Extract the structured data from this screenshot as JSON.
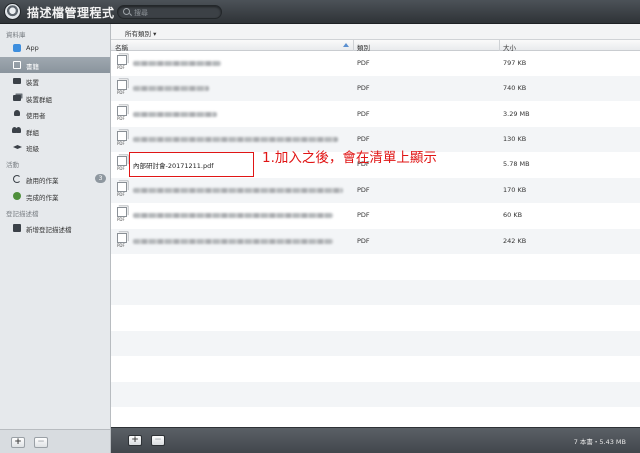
{
  "app": {
    "title": "描述檔管理程式"
  },
  "search": {
    "placeholder": "搜尋"
  },
  "sidebar": {
    "library_heading": "資料庫",
    "library_items": [
      {
        "label": "App",
        "icon": "app-icon",
        "active": false
      },
      {
        "label": "書籍",
        "icon": "book-icon",
        "active": true
      },
      {
        "label": "裝置",
        "icon": "device-icon",
        "active": false
      },
      {
        "label": "裝置群組",
        "icon": "device-group-icon",
        "active": false
      },
      {
        "label": "使用者",
        "icon": "user-icon",
        "active": false
      },
      {
        "label": "群組",
        "icon": "group-icon",
        "active": false
      },
      {
        "label": "班級",
        "icon": "class-icon",
        "active": false
      }
    ],
    "activity_heading": "活動",
    "activity_items": [
      {
        "label": "啟用的作業",
        "icon": "active-tasks-icon",
        "badge": "3"
      },
      {
        "label": "完成的作業",
        "icon": "completed-tasks-icon"
      }
    ],
    "enrollment_heading": "登記描述檔",
    "enrollment_items": [
      {
        "label": "新增登記描述檔",
        "icon": "new-enrollment-icon"
      }
    ],
    "add_label": "+",
    "remove_label": "−"
  },
  "main": {
    "filter_label": "所有類別 ▾",
    "columns": {
      "name": "名稱",
      "type": "類別",
      "size": "大小"
    },
    "rows": [
      {
        "name": "",
        "type": "PDF",
        "size": "797 KB"
      },
      {
        "name": "",
        "type": "PDF",
        "size": "740 KB"
      },
      {
        "name": "",
        "type": "PDF",
        "size": "3.29 MB"
      },
      {
        "name": "",
        "type": "PDF",
        "size": "130 KB"
      },
      {
        "name": "內部研討會-20171211.pdf",
        "type": "PDF",
        "size": "5.78 MB"
      },
      {
        "name": "",
        "type": "PDF",
        "size": "170 KB"
      },
      {
        "name": "",
        "type": "PDF",
        "size": "60 KB"
      },
      {
        "name": "",
        "type": "PDF",
        "size": "242 KB"
      }
    ],
    "doc_tag": "PDF",
    "annotation": "1.加入之後，會在清單上顯示",
    "footer_count": "7 本書・5.43 MB",
    "add_label": "+",
    "remove_label": "−"
  },
  "colors": {
    "annotation": "#e01515",
    "titlebar": "#3a3f44",
    "sidebar": "#e6e9ec"
  }
}
